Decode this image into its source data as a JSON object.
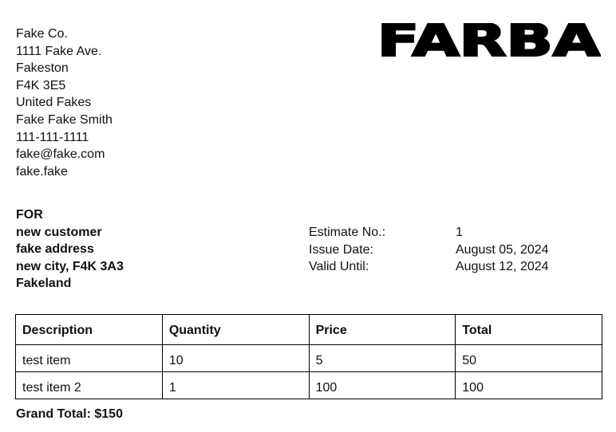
{
  "company": {
    "lines": [
      "Fake Co.",
      "1111 Fake Ave.",
      "Fakeston",
      "F4K 3E5",
      "United Fakes",
      "Fake Fake Smith",
      "111-111-1111",
      "fake@fake.com",
      "fake.fake"
    ],
    "logo_text": "FARBA"
  },
  "customer": {
    "heading": "FOR",
    "lines": [
      "new customer",
      "fake address",
      "new city, F4K 3A3",
      "Fakeland"
    ]
  },
  "estimate": {
    "number_label": "Estimate No.:",
    "number_value": "1",
    "issue_label": "Issue Date:",
    "issue_value": "August 05, 2024",
    "valid_label": "Valid Until:",
    "valid_value": "August 12, 2024"
  },
  "table": {
    "headers": [
      "Description",
      "Quantity",
      "Price",
      "Total"
    ],
    "rows": [
      [
        "test item",
        "10",
        "5",
        "50"
      ],
      [
        "test item 2",
        "1",
        "100",
        "100"
      ]
    ]
  },
  "grand_total": "Grand Total: $150"
}
